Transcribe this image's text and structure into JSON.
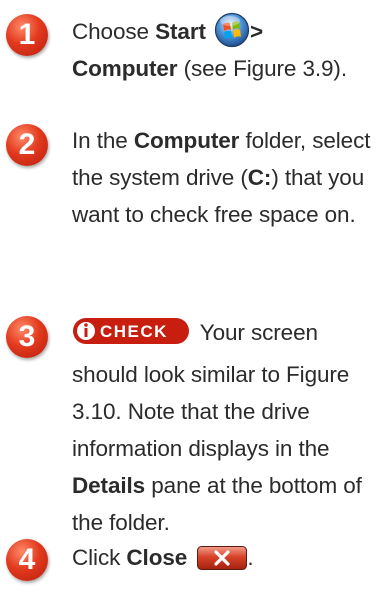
{
  "steps": [
    {
      "number": "1",
      "parts": {
        "a": "Choose ",
        "b": "Start",
        "c": ">",
        "d": "Computer",
        "e": " (see Figure 3.9)."
      }
    },
    {
      "number": "2",
      "parts": {
        "a": "In the ",
        "b": "Computer",
        "c": " folder, select the system drive (",
        "d": "C:",
        "e": ") that you want to check free space on."
      }
    },
    {
      "number": "3",
      "check_label": "CHECK",
      "parts": {
        "a": " Your screen should look similar to Figure 3.10. Note that the drive information displays in the ",
        "b": "Details",
        "c": " pane at the bottom of the folder."
      }
    },
    {
      "number": "4",
      "parts": {
        "a": "Click ",
        "b": "Close",
        "c": "."
      }
    }
  ],
  "icons": {
    "start": "windows-start-orb-icon",
    "close": "close-x-button-icon",
    "check": "check-info-icon"
  },
  "colors": {
    "badge": "#e23a1e",
    "text": "#2b2b2b",
    "close_button": "#d9432a"
  }
}
